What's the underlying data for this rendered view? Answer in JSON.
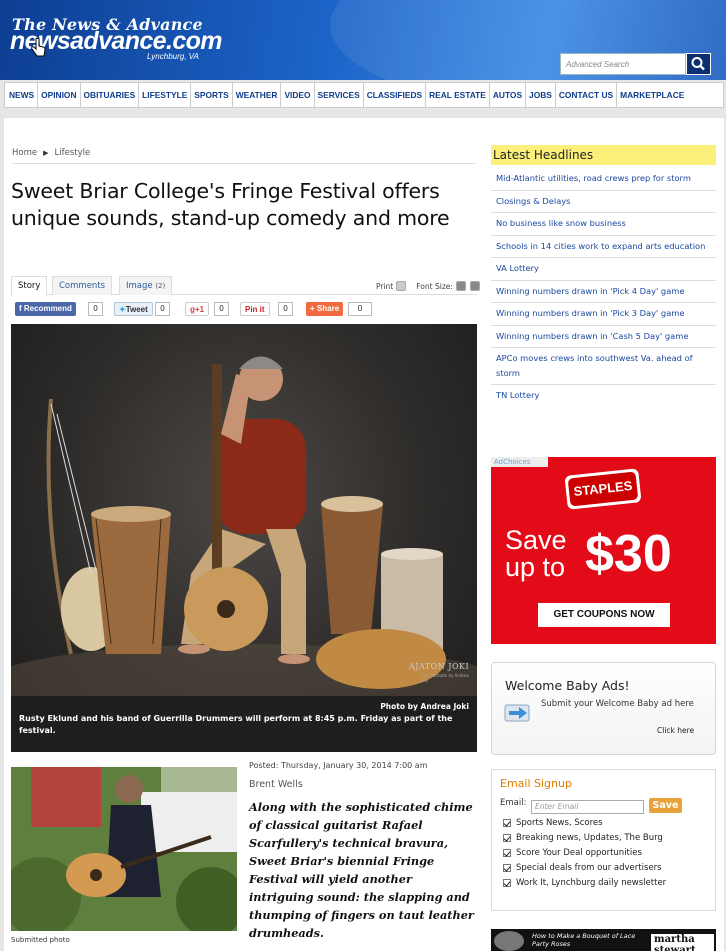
{
  "header": {
    "logo_top": "The News & Advance",
    "logo_main": "newsadvance.com",
    "logo_sub": "Lynchburg, VA",
    "search_placeholder": "Advanced Search"
  },
  "nav": {
    "items": [
      "NEWS",
      "OPINION",
      "OBITUARIES",
      "LIFESTYLE",
      "SPORTS",
      "WEATHER",
      "VIDEO",
      "SERVICES",
      "CLASSIFIEDS",
      "REAL ESTATE",
      "AUTOS",
      "JOBS",
      "CONTACT US",
      "MARKETPLACE"
    ]
  },
  "breadcrumb": {
    "home": "Home",
    "section": "Lifestyle"
  },
  "article": {
    "headline": "Sweet Briar College's Fringe Festival offers unique sounds, stand-up comedy and more",
    "tabs": {
      "story": "Story",
      "comments": "Comments",
      "image": "Image",
      "image_count": "(2)"
    },
    "tools": {
      "print": "Print",
      "font_size": "Font Size:"
    },
    "social": {
      "recommend": "Recommend",
      "recommend_count": "0",
      "tweet": "Tweet",
      "tweet_count": "0",
      "gplus": "+1",
      "gplus_count": "0",
      "pinit": "Pin it",
      "pinit_count": "0",
      "share": "Share",
      "share_count": "0"
    },
    "hero_credit": "Photo by Andrea Joki",
    "hero_caption": "Rusty Eklund and his band of Guerrilla Drummers will perform at 8:45 p.m. Friday as part of the festival.",
    "watermark": "AJATON JOKI",
    "watermark_sub": "Fine Portraits by Andrea Joki",
    "thumb_caption": "Submitted photo",
    "posted": "Posted: Thursday, January 30, 2014 7:00 am",
    "author": "Brent Wells",
    "lede": "Along with the sophisticated chime of classical guitarist Rafael Scarfullery's technical bravura, Sweet Briar's biennial Fringe Festival will yield another intriguing sound: the slapping and thumping of fingers on taut leather drumheads."
  },
  "sidebar": {
    "latest_title": "Latest Headlines",
    "headlines": [
      "Mid-Atlantic utilities, road crews prep for storm",
      "Closings & Delays",
      "No business like snow business",
      "Schools in 14 cities work to expand arts education",
      "VA Lottery",
      "Winning numbers drawn in 'Pick 4 Day' game",
      "Winning numbers drawn in 'Pick 3 Day' game",
      "Winning numbers drawn in 'Cash 5 Day' game",
      "APCo moves crews into southwest Va. ahead of storm",
      "TN Lottery"
    ],
    "ad": {
      "adchoices": "AdChoices",
      "brand": "STAPLES",
      "save_line1": "Save",
      "save_line2": "up to",
      "amount": "$30",
      "button": "GET COUPONS NOW",
      "color": "#e20b17"
    },
    "welcome_baby": {
      "title": "Welcome Baby Ads!",
      "text": "Submit your Welcome Baby ad here",
      "link": "Click here"
    },
    "email_signup": {
      "title": "Email Signup",
      "email_label": "Email:",
      "email_placeholder": "Enter Email",
      "button": "Save",
      "options": [
        "Sports News, Scores",
        "Breaking news, Updates, The Burg",
        "Score Your Deal opportunities",
        "Special deals from our advertisers",
        "Work It, Lynchburg daily newsletter"
      ]
    },
    "video": {
      "title": "How to Make a Bouquet of Lace Party Roses",
      "brand": "martha stewart"
    }
  }
}
